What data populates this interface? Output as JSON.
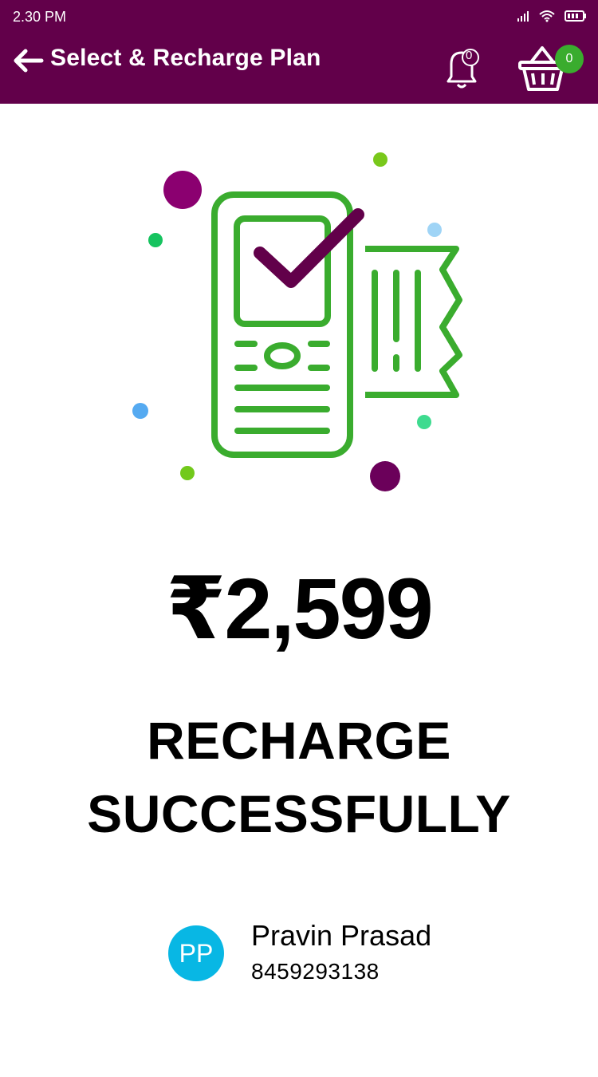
{
  "status_bar": {
    "time": "2.30 PM",
    "icons": [
      "signal-icon",
      "wifi-icon",
      "battery-icon"
    ]
  },
  "header": {
    "title": "Select & Recharge Plan",
    "bell_count": "0",
    "cart_count": "0",
    "background_color": "#62004a"
  },
  "illustration": {
    "name": "recharge-success-illustration",
    "phone_color": "#3aac2e",
    "check_color": "#62004a"
  },
  "result": {
    "amount": "₹2,599",
    "message_line1": "RECHARGE",
    "message_line2": "SUCCESSFULLY"
  },
  "contact": {
    "initials": "PP",
    "name": "Pravin Prasad",
    "phone": "8459293138",
    "avatar_color": "#08b7e4"
  }
}
